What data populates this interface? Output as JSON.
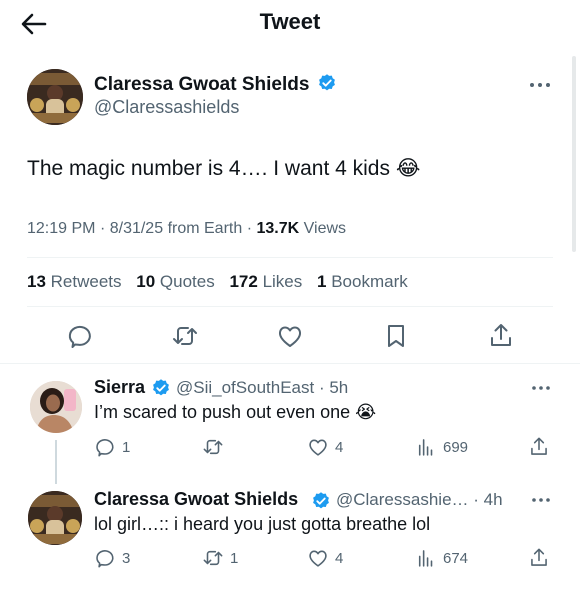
{
  "header": {
    "title": "Tweet",
    "back_icon": "arrow-left-icon"
  },
  "colors": {
    "verified": "#1d9bf0",
    "text": "#0f1419",
    "muted": "#536471",
    "divider": "#eff3f4"
  },
  "main_tweet": {
    "author_name": "Claressa Gwoat Shields",
    "handle": "@Claressashields",
    "text": "The magic number is 4…. I want 4 kids 😂",
    "time": "12:19 PM",
    "date": "8/31/25",
    "source": "from Earth",
    "views_count": "13.7K",
    "views_label": "Views",
    "stats": {
      "retweets_count": "13",
      "retweets_label": "Retweets",
      "quotes_count": "10",
      "quotes_label": "Quotes",
      "likes_count": "172",
      "likes_label": "Likes",
      "bookmarks_count": "1",
      "bookmarks_label": "Bookmark"
    }
  },
  "replies": [
    {
      "author_name": "Sierra",
      "handle": "@Sii_ofSouthEast",
      "age": "5h",
      "text": "I’m scared to push out even one 😭",
      "reply_count": "1",
      "retweet_count": "",
      "like_count": "4",
      "view_count": "699"
    },
    {
      "author_name": "Claressa Gwoat Shields",
      "handle": "@Claressashie…",
      "age": "4h",
      "text": "lol girl…:: i heard you just gotta breathe lol",
      "reply_count": "3",
      "retweet_count": "1",
      "like_count": "4",
      "view_count": "674"
    }
  ]
}
